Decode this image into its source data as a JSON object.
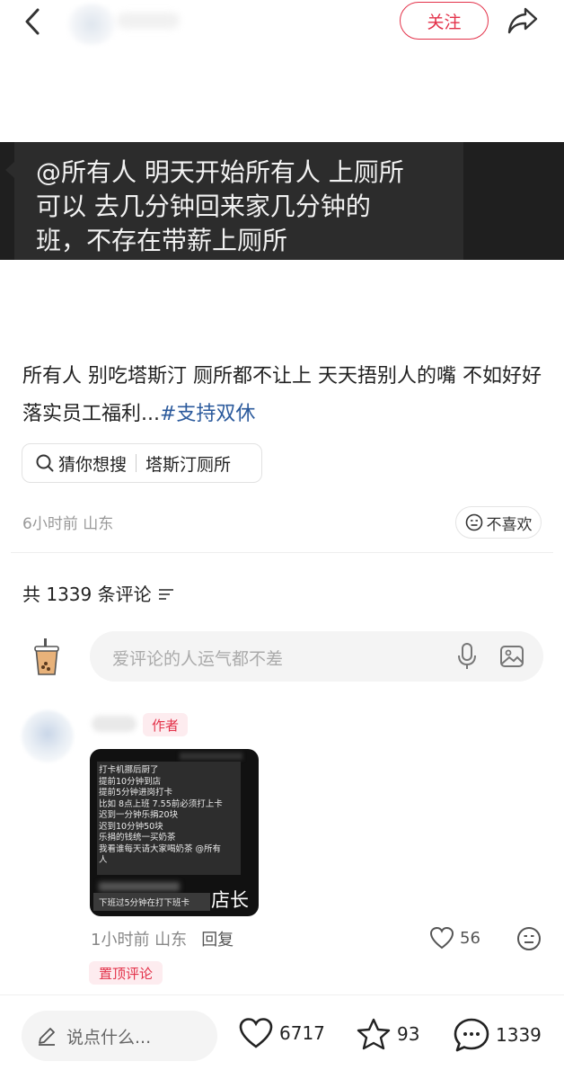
{
  "header": {
    "follow_label": "关注",
    "icons": [
      "chevron-left-icon",
      "share-icon"
    ]
  },
  "image_banner": {
    "lines": [
      "@所有人 明天开始所有人 上厕所",
      "可以  去几分钟回来家几分钟的",
      "班，不存在带薪上厕所"
    ]
  },
  "post": {
    "text": "所有人 别吃塔斯汀 厕所都不让上 天天捂别人的嘴 不如好好落实员工福利...",
    "hashtag": "#支持双休",
    "search_prefix": "猜你想搜",
    "search_term": "塔斯汀厕所",
    "time_location": "6小时前 山东",
    "dislike_label": "不喜欢"
  },
  "comments_section": {
    "count_label": "共 1339 条评论",
    "input_placeholder": "爱评论的人运气都不差",
    "comment": {
      "author_tag": "作者",
      "image_lines": [
        "打卡机挪后厨了",
        "提前10分钟到店",
        " 提前5分钟进岗打卡",
        "比如 8点上班 7.55前必须打上卡",
        "迟到一分钟乐捐20块",
        "迟到10分钟50块",
        " 乐捐的钱统一买奶茶",
        "我看谁每天请大家喝奶茶 @所有",
        "人"
      ],
      "image_bottom_text": "下班过5分钟在打下班卡",
      "image_caption": "店长",
      "time_location": "1小时前 山东",
      "reply_label": "回复",
      "like_count": "56",
      "pinned_label": "置顶评论"
    }
  },
  "bottom_bar": {
    "input_placeholder": "说点什么...",
    "likes": "6717",
    "favorites": "93",
    "comments": "1339"
  },
  "colors": {
    "accent": "#e3324a",
    "hashtag": "#2b5a9c",
    "banner_bg": "#1f1f1f"
  }
}
